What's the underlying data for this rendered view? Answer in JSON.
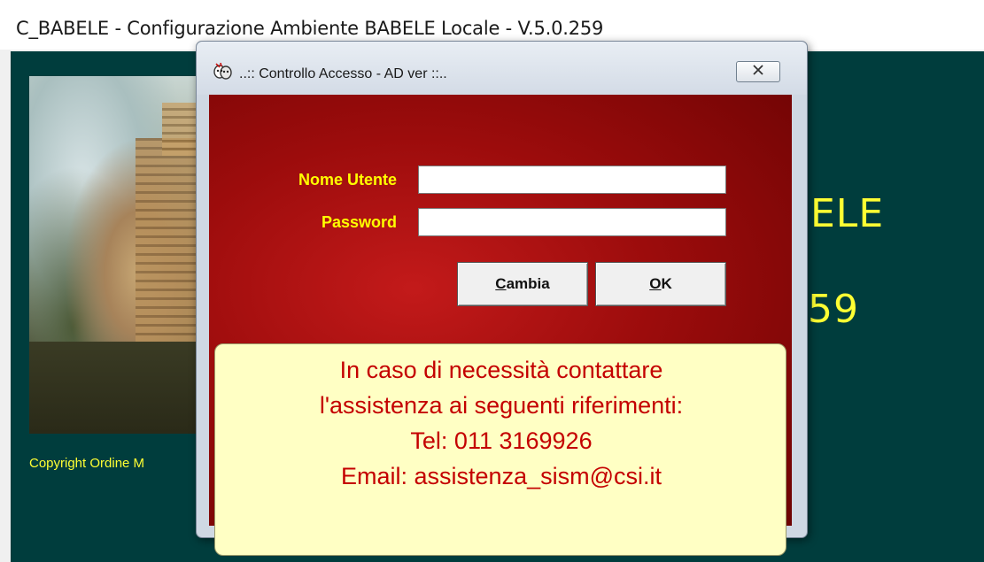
{
  "main_window": {
    "title": "C_BABELE - Configurazione Ambiente BABELE Locale - V.5.0.259",
    "copyright": "Copyright Ordine M",
    "big_text_1": "ELE",
    "big_text_2": "59"
  },
  "dialog": {
    "title": "..:: Controllo Accesso - AD ver ::..",
    "username_label": "Nome Utente",
    "username_value": "",
    "password_label": "Password",
    "password_value": "",
    "cambia_button": {
      "mnemonic": "C",
      "rest": "ambia"
    },
    "ok_button": {
      "mnemonic": "O",
      "rest": "K"
    },
    "info_lines": [
      "In caso di necessità contattare",
      "l'assistenza ai seguenti riferimenti:",
      "Tel:  011 3169926",
      "Email: assistenza_sism@csi.it"
    ]
  },
  "colors": {
    "main_background": "#003d3d",
    "accent_yellow": "#ffff33",
    "dialog_red": "#9c0c0c",
    "info_background": "#ffffc4",
    "info_text": "#c40000"
  },
  "icons": [
    "app-mask-icon",
    "close-icon"
  ]
}
